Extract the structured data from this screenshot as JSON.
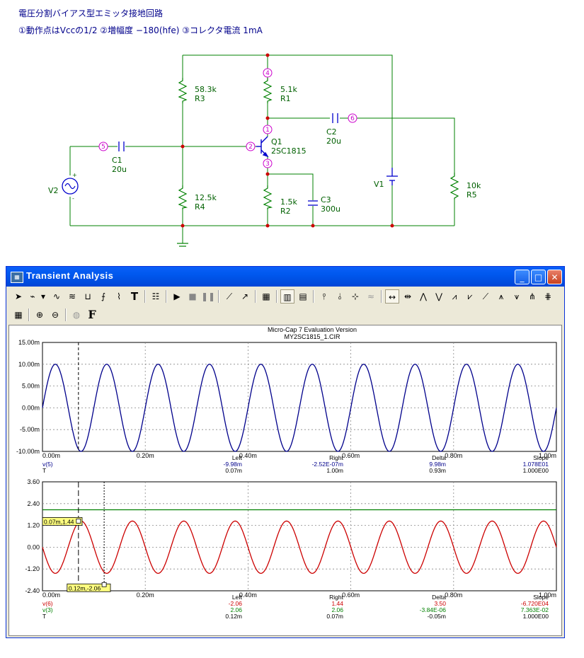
{
  "header": {
    "line1": "電圧分割バイアス型エミッタ接地回路",
    "line2": "①動作点はVccの1/2 ②増幅度 −180(hfe) ③コレクタ電流 1mA"
  },
  "schematic": {
    "nodes": {
      "n1": "1",
      "n2": "2",
      "n3": "3",
      "n4": "4",
      "n5": "5",
      "n6": "6"
    },
    "parts": {
      "R3_val": "58.3k",
      "R3_name": "R3",
      "R1_val": "5.1k",
      "R1_name": "R1",
      "C2_name": "C2",
      "C2_val": "20u",
      "Q1_name": "Q1",
      "Q1_model": "2SC1815",
      "C1_name": "C1",
      "C1_val": "20u",
      "V2_name": "V2",
      "R4_val": "12.5k",
      "R4_name": "R4",
      "R2_val": "1.5k",
      "R2_name": "R2",
      "C3_name": "C3",
      "C3_val": "300u",
      "V1_name": "V1",
      "R5_val": "10k",
      "R5_name": "R5",
      "plus": "+",
      "minus": "-"
    },
    "colors": {
      "wire": "#008000",
      "node": "#cc00cc",
      "text": "#006000"
    }
  },
  "window": {
    "title": "Transient Analysis",
    "minimize": "_",
    "maximize": "□",
    "close": "✕",
    "toolbar1_icons": [
      "select-arrow-icon",
      "component-icon",
      "dropdown-icon",
      "scope-icon",
      "waveform-icon",
      "cursor-mode-icon",
      "range-icon",
      "stepping-icon",
      "text-icon",
      "properties-icon",
      "run-icon",
      "stop-icon",
      "pause-icon",
      "line-icon",
      "arrow-line-icon",
      "grid-icon",
      "grid-bold-icon",
      "grid-minor-icon",
      "peak-icon",
      "valley-icon",
      "high-icon",
      "low-icon",
      "slope-icon",
      "left-right-cursor-icon",
      "cursor-cross-icon",
      "peak-wave-icon",
      "valley-wave-icon",
      "inflection-icon",
      "global-high-icon",
      "global-low-icon",
      "curve-tool-icon",
      "tag-icon",
      "tag-horizontal-icon"
    ],
    "toolbar2_icons": [
      "data-table-icon",
      "zoom-in-icon",
      "zoom-out-icon",
      "globe-icon",
      "font-icon"
    ],
    "text_icon_glyph": "T",
    "font_icon_glyph": "F"
  },
  "chart_data": [
    {
      "type": "line",
      "title": "Micro-Cap 7 Evaluation Version",
      "subtitle": "MY2SC1815_1.CIR",
      "x_ticks": [
        "0.00m",
        "0.20m",
        "0.40m",
        "0.60m",
        "0.80m",
        "1.00m"
      ],
      "y_ticks": [
        "15.00m",
        "10.00m",
        "5.00m",
        "0.00m",
        "-5.00m",
        "-10.00m"
      ],
      "xlim": [
        0,
        1.0
      ],
      "ylim": [
        -10.0,
        15.0
      ],
      "grid": true,
      "series": [
        {
          "name": "v(5)",
          "color": "#00008b",
          "amplitude": 10.0,
          "frequency_khz": 10,
          "phase": "sin"
        }
      ],
      "cursor_left_x": 0.07,
      "readout": {
        "headers": [
          "Left",
          "Right",
          "Delta",
          "Slope"
        ],
        "rows": [
          {
            "label": "v(5)",
            "color": "#00008b",
            "values": [
              "-9.98m",
              "-2.52E-07m",
              "9.98m",
              "1.078E01"
            ]
          },
          {
            "label": "T",
            "color": "#000000",
            "values": [
              "0.07m",
              "1.00m",
              "0.93m",
              "1.000E00"
            ]
          }
        ]
      }
    },
    {
      "type": "line",
      "x_ticks": [
        "0.00m",
        "0.20m",
        "0.40m",
        "0.60m",
        "0.80m",
        "1.00m"
      ],
      "y_ticks": [
        "3.60",
        "2.40",
        "1.20",
        "0.00",
        "-1.20",
        "-2.40"
      ],
      "xlim": [
        0,
        1.0
      ],
      "ylim": [
        -2.4,
        3.6
      ],
      "grid": true,
      "series": [
        {
          "name": "v(6)",
          "color": "#cc0000",
          "amplitude": 1.44,
          "frequency_khz": 10,
          "phase": "-sin"
        },
        {
          "name": "v(3)",
          "color": "#008000",
          "constant": 2.06
        }
      ],
      "cursor_left_x": 0.07,
      "cursor_right_x": 0.12,
      "tags": [
        {
          "text": "0.07m,1.44"
        },
        {
          "text": "0.12m,-2.06"
        }
      ],
      "readout": {
        "headers": [
          "Left",
          "Right",
          "Delta",
          "Slope"
        ],
        "rows": [
          {
            "label": "v(6)",
            "color": "#cc0000",
            "values": [
              "-2.06",
              "1.44",
              "3.50",
              "-6.720E04"
            ]
          },
          {
            "label": "v(3)",
            "color": "#008000",
            "values": [
              "2.06",
              "2.06",
              "-3.84E-06",
              "7.363E-02"
            ]
          },
          {
            "label": "T",
            "color": "#000000",
            "values": [
              "0.12m",
              "0.07m",
              "-0.05m",
              "1.000E00"
            ]
          }
        ]
      }
    }
  ]
}
